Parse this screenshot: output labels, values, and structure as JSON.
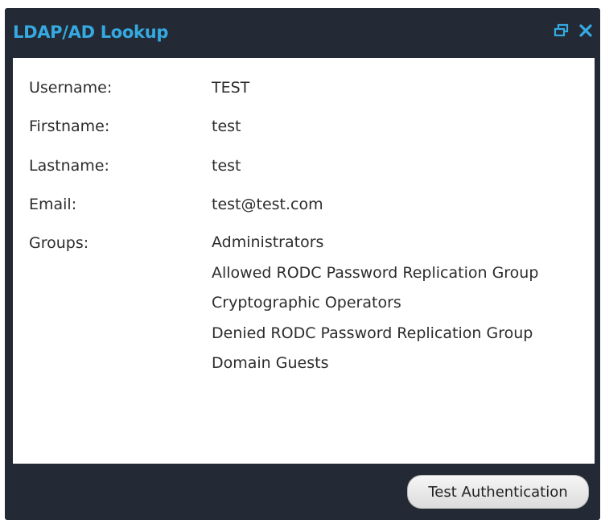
{
  "window": {
    "title": "LDAP/AD Lookup",
    "icons": [
      "restore-icon",
      "close-icon"
    ],
    "accent_color": "#35a9e1",
    "frame_color": "#232a35"
  },
  "fields": {
    "username": {
      "label": "Username:",
      "value": "TEST"
    },
    "firstname": {
      "label": "Firstname:",
      "value": "test"
    },
    "lastname": {
      "label": "Lastname:",
      "value": "test"
    },
    "email": {
      "label": "Email:",
      "value": "test@test.com"
    },
    "groups": {
      "label": "Groups:",
      "items": [
        "Administrators",
        "Allowed RODC Password Replication Group",
        "Cryptographic Operators",
        "Denied RODC Password Replication Group",
        "Domain Guests"
      ]
    }
  },
  "footer": {
    "button_label": "Test Authentication"
  }
}
